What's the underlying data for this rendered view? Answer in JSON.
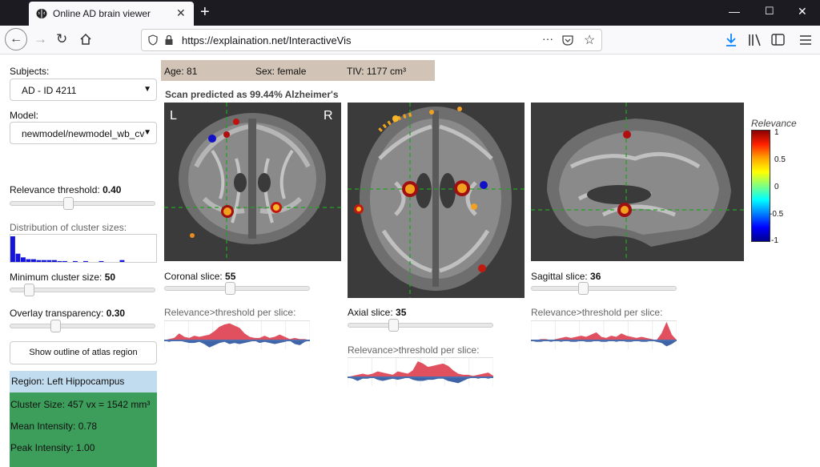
{
  "browser": {
    "tab_title": "Online AD brain viewer",
    "url": "https://explaination.net/InteractiveVis",
    "new_tab_label": "+"
  },
  "sidebar": {
    "subjects_label": "Subjects:",
    "subject_value": "AD - ID 4211",
    "model_label": "Model:",
    "model_value": "newmodel/newmodel_wb_cv",
    "relevance_threshold_label": "Relevance threshold:",
    "relevance_threshold_value": "0.40",
    "relevance_threshold_fraction": 0.4,
    "distribution_label": "Distribution of cluster sizes:",
    "distribution_bars": [
      28,
      9,
      5,
      3,
      3,
      2,
      2,
      2,
      2,
      1,
      1,
      0,
      1,
      0,
      1,
      0,
      0,
      1,
      0,
      0,
      0,
      2,
      0,
      0,
      0,
      0,
      0,
      0
    ],
    "min_cluster_label": "Minimum cluster size:",
    "min_cluster_value": "50",
    "min_cluster_fraction": 0.1,
    "overlay_label": "Overlay transparency:",
    "overlay_value": "0.30",
    "overlay_fraction": 0.3,
    "show_outline_button": "Show outline of atlas region",
    "region": "Region: Left Hippocampus",
    "cluster_size": "Cluster Size: 457 vx = 1542 mm³",
    "mean_intensity": "Mean Intensity: 0.78",
    "peak_intensity": "Peak Intensity: 1.00"
  },
  "info_bar": {
    "age": "Age: 81",
    "sex": "Sex: female",
    "tiv": "TIV: 1177 cm³"
  },
  "prediction": "Scan predicted as 99.44% Alzheimer's",
  "coronal": {
    "left_marker": "L",
    "right_marker": "R",
    "slice_label": "Coronal slice:",
    "slice_value": "55",
    "slice_fraction": 0.45,
    "plot_title": "Relevance>threshold per slice:"
  },
  "axial": {
    "slice_label": "Axial slice:",
    "slice_value": "35",
    "slice_fraction": 0.3,
    "plot_title": "Relevance>threshold per slice:"
  },
  "sagittal": {
    "slice_label": "Sagittal slice:",
    "slice_value": "36",
    "slice_fraction": 0.35,
    "plot_title": "Relevance>threshold per slice:"
  },
  "colorbar": {
    "title": "Relevance",
    "ticks": [
      "1",
      "0.5",
      "0",
      "-0.5",
      "-1"
    ]
  },
  "colors": {
    "info_bar_bg": "#d1c3b5",
    "region_bg": "#c2dcef",
    "stats_bg": "#3d9e5b",
    "distribution_bar": "#1414dc",
    "relevance_positive": "#e0505e",
    "relevance_negative": "#3e63a6"
  }
}
